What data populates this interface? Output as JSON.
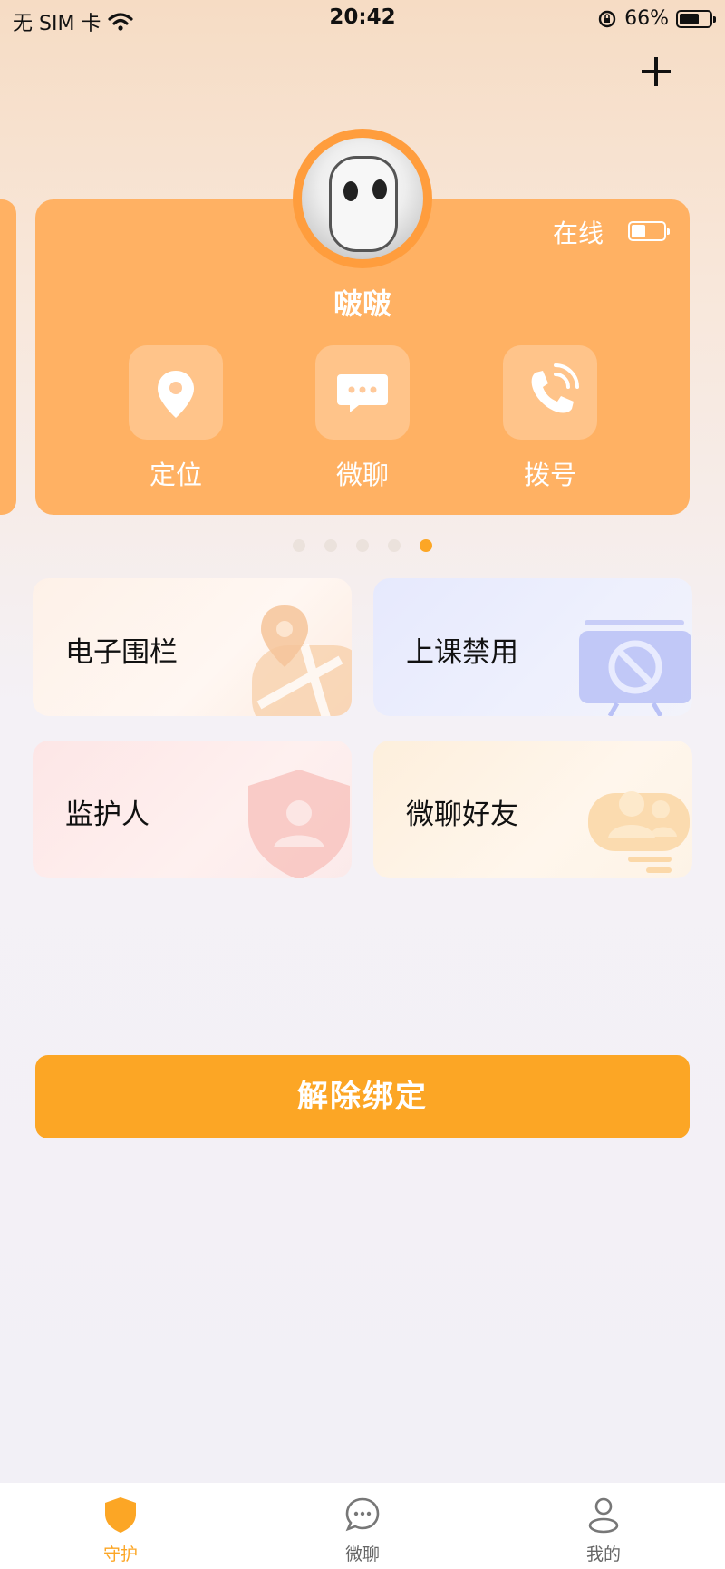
{
  "status_bar": {
    "carrier": "无 SIM 卡",
    "time": "20:42",
    "battery": "66%",
    "battery_level": 0.66
  },
  "device": {
    "name": "啵啵",
    "status": "在线",
    "battery_level": 0.45
  },
  "actions": [
    {
      "label": "定位",
      "icon": "location-pin-icon"
    },
    {
      "label": "微聊",
      "icon": "chat-bubble-icon"
    },
    {
      "label": "拨号",
      "icon": "phone-icon"
    }
  ],
  "pager": {
    "count": 5,
    "active_index": 4
  },
  "features": [
    {
      "label": "电子围栏",
      "icon": "map-pin-icon"
    },
    {
      "label": "上课禁用",
      "icon": "no-entry-board-icon"
    },
    {
      "label": "监护人",
      "icon": "shield-user-icon"
    },
    {
      "label": "微聊好友",
      "icon": "friends-icon"
    }
  ],
  "unbind_button": "解除绑定",
  "tabbar": [
    {
      "label": "守护",
      "icon": "shield-icon",
      "active": true
    },
    {
      "label": "微聊",
      "icon": "chat-icon",
      "active": false
    },
    {
      "label": "我的",
      "icon": "person-icon",
      "active": false
    }
  ],
  "colors": {
    "accent": "#fca625",
    "card": "#ffb163",
    "ring": "#ff9d3d"
  }
}
